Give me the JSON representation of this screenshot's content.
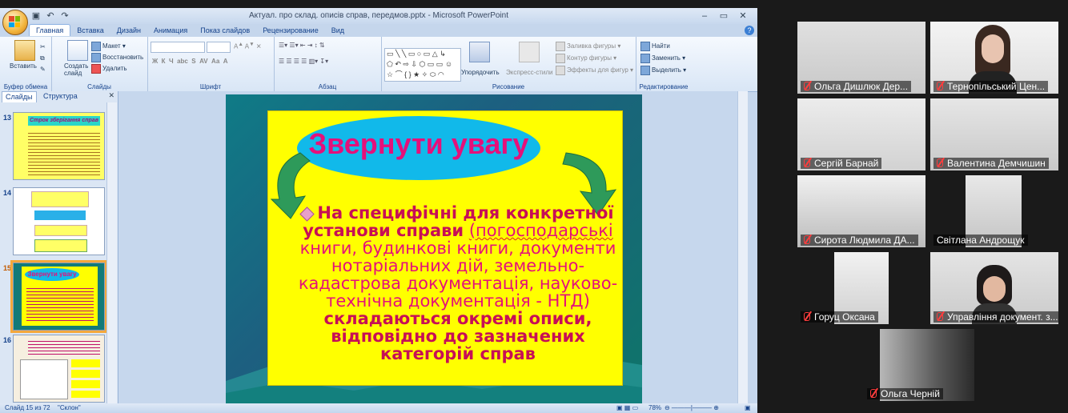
{
  "ppt": {
    "qat_icons": [
      "save-icon",
      "undo-icon",
      "redo-icon"
    ],
    "title": "Актуал. про склад. описів справ, передмов.pptx - Microsoft PowerPoint",
    "tabs": [
      "Главная",
      "Вставка",
      "Дизайн",
      "Анимация",
      "Показ слайдов",
      "Рецензирование",
      "Вид"
    ],
    "groups": {
      "clipboard": {
        "label": "Буфер обмена",
        "paste": "Вставить"
      },
      "slides": {
        "label": "Слайды",
        "create": "Создать слайд",
        "layout": "Макет",
        "restore": "Восстановить",
        "delete": "Удалить"
      },
      "font": {
        "label": "Шрифт"
      },
      "paragraph": {
        "label": "Абзац"
      },
      "drawing": {
        "label": "Рисование",
        "arrange": "Упорядочить",
        "quick_styles": "Экспресс-стили",
        "fill": "Заливка фигуры",
        "outline": "Контур фигуры",
        "effects": "Эффекты для фигур"
      },
      "editing": {
        "label": "Редактирование",
        "find": "Найти",
        "replace": "Заменить",
        "select": "Выделить"
      }
    },
    "panel_tabs": [
      "Слайды",
      "Структура"
    ],
    "thumbs": [
      {
        "num": "13",
        "title": "Строк зберігання справ"
      },
      {
        "num": "14"
      },
      {
        "num": "15",
        "title": "Звернути увагу"
      },
      {
        "num": "16"
      }
    ],
    "slide": {
      "heading": "Звернути увагу",
      "line1_bold": "На специфічні для конкретної установи справи",
      "line1_underlined": "(погосподарські",
      "line2": "книги, будинкові книги, документи нотаріальних дій, земельно-кадастрова документація, науково-технічна документація - НТД)",
      "line3_bold": "складаються окремі описи, відповідно до зазначених категорій справ"
    },
    "status": {
      "slide": "Слайд 15 из 72",
      "theme": "\"Склон\"",
      "zoom": "78%"
    }
  },
  "participants": [
    {
      "name": "Ольга Дишлюк Дер..."
    },
    {
      "name": "Тернопільський Цен..."
    },
    {
      "name": "Сергій Барнай"
    },
    {
      "name": "Валентина Демчишин"
    },
    {
      "name": "Сирота Людмила ДА..."
    },
    {
      "name": "Світлана Андрощук"
    },
    {
      "name": "Горуц Оксана"
    },
    {
      "name": "Управління документ. з..."
    },
    {
      "name": "Ольга Черній"
    }
  ]
}
